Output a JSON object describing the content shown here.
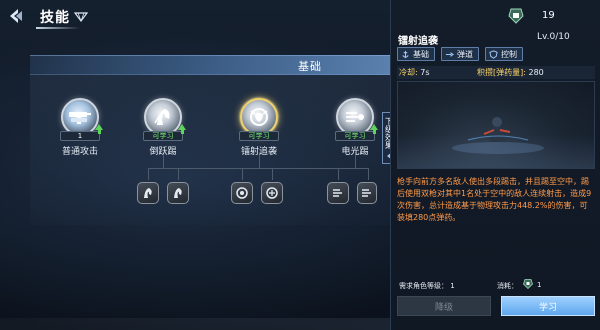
{
  "header": {
    "title": "技能"
  },
  "tree": {
    "section_title": "基础",
    "nodes": [
      {
        "label": "普通攻击",
        "badge": "1"
      },
      {
        "label": "倒跃踢",
        "badge": "可学习"
      },
      {
        "label": "镭射追袭",
        "badge": "可学习"
      },
      {
        "label": "电光踢",
        "badge": "可学习"
      }
    ],
    "side_tab_label": "下级效果"
  },
  "detail": {
    "currency_count": "19",
    "skill_name": "镭射追袭",
    "level": "Lv.0/10",
    "tags": [
      "基础",
      "弹道",
      "控制"
    ],
    "cooldown_label": "冷却:",
    "cooldown_value": "7s",
    "capacity_label": "积攒[弹药量]:",
    "capacity_value": "280",
    "description": "枪手向前方多名敌人使出多段踢击，并且踢至空中，踢后使用双枪对其中1名处于空中的敌人连续射击，造成9次伤害，总计造成基于物理攻击力448.2%的伤害，可装填280点弹药。",
    "requirement_label": "需求角色等级：",
    "requirement_value": "1",
    "cost_label": "消耗：",
    "cost_value": "1",
    "downgrade_label": "降级",
    "learn_label": "学习"
  },
  "colors": {
    "accent_blue": "#5ea6ec",
    "learnable_green": "#7cf07a",
    "description_orange": "#ff9b4a",
    "stat_label_yellow": "#ffd76b",
    "selected_gold": "#f0d26a"
  }
}
